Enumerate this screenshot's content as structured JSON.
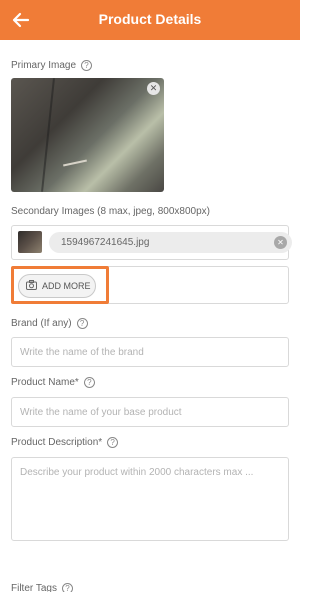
{
  "appbar": {
    "title": "Product Details"
  },
  "primary": {
    "label": "Primary Image",
    "help": "?"
  },
  "secondary": {
    "label": "Secondary Images (8 max, jpeg, 800x800px)",
    "file_name": "1594967241645.jpg",
    "add_more_label": "ADD MORE"
  },
  "brand": {
    "label": "Brand (If any)",
    "help": "?",
    "placeholder": "Write the name of the brand"
  },
  "product_name": {
    "label": "Product Name*",
    "help": "?",
    "placeholder": "Write the name of your base product"
  },
  "description": {
    "label": "Product Description*",
    "help": "?",
    "placeholder": "Describe your product within 2000 characters max ..."
  },
  "filter_tags": {
    "label": "Filter Tags",
    "help": "?"
  },
  "icons": {
    "back": "arrow-back-icon",
    "close": "close-icon",
    "camera": "camera-icon",
    "help": "help-circle-icon"
  },
  "colors": {
    "accent": "#f07c37"
  }
}
